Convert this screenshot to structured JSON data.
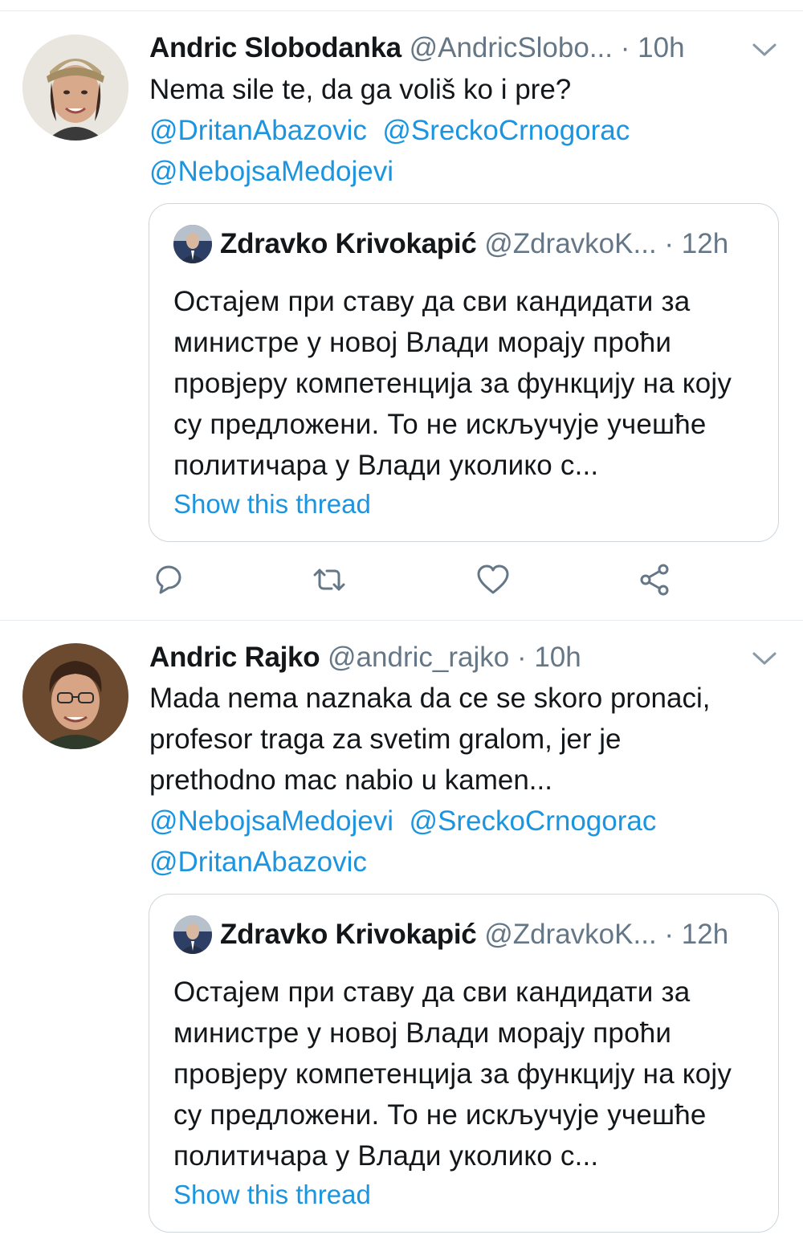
{
  "tweets": [
    {
      "author_name": "Andric Slobodanka",
      "author_handle": "@AndricSlobo...",
      "time": "10h",
      "text_lines": [
        "Nema sile te, da ga voliš ko i pre?"
      ],
      "mention_lines": [
        [
          "@DritanAbazovic",
          "@SreckoCrnogorac"
        ],
        [
          "@NebojsaMedojevi"
        ]
      ],
      "quote": {
        "author_name": "Zdravko Krivokapić",
        "author_handle": "@ZdravkoK...",
        "time": "12h",
        "text": "Остајем при ставу да сви кандидати за министре у новој Влади морају проћи провјеру компетенција за функцију на коју су предложени. То не искључује учешће политичара у Влади уколико с...",
        "show_thread": "Show this thread"
      }
    },
    {
      "author_name": "Andric Rajko",
      "author_handle": "@andric_rajko",
      "time": "10h",
      "text_lines": [
        "Mada nema naznaka da ce se skoro pronaci,",
        "profesor traga za svetim gralom, jer je",
        "prethodno mac nabio u kamen..."
      ],
      "mention_lines": [
        [
          "@NebojsaMedojevi",
          "@SreckoCrnogorac"
        ],
        [
          "@DritanAbazovic"
        ]
      ],
      "quote": {
        "author_name": "Zdravko Krivokapić",
        "author_handle": "@ZdravkoK...",
        "time": "12h",
        "text": "Остајем при ставу да сви кандидати за министре у новој Влади морају проћи провјеру компетенција за функцију на коју су предложени. То не искључује учешће политичара у Влади уколико с...",
        "show_thread": "Show this thread"
      }
    }
  ],
  "actions": [
    "reply-icon",
    "retweet-icon",
    "like-icon",
    "share-icon"
  ],
  "colors": {
    "link": "#1b95e0",
    "muted": "#657786",
    "border": "#ccd6dd"
  }
}
